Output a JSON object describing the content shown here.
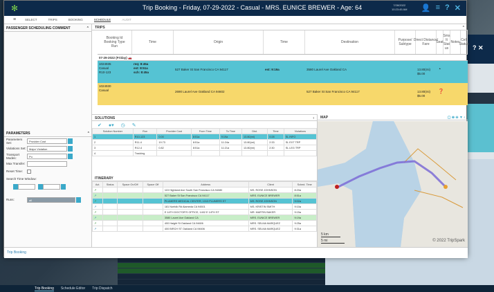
{
  "window": {
    "title": "Trip Booking - Friday, 07-29-2022 - Casual - MRS. EUNICE BREWER - Age: 64",
    "datetime": "7/28/2022\n10:23:45 AM"
  },
  "menu": {
    "items": [
      "SELECT",
      "TRIPS",
      "BOOKING",
      "SCHEDULE",
      "AUDIT"
    ],
    "selected": "SCHEDULE"
  },
  "left_panel": {
    "header": "PASSENGER SCHEDULING COMMENT",
    "params_header": "PARAMETERS",
    "params": [
      {
        "label": "Parameters Set:",
        "value": "Provider Cost"
      },
      {
        "label": "Violations Set:",
        "value": "Major Violation"
      },
      {
        "label": "Transport Modes:",
        "value": "Pu"
      },
      {
        "label": "Max Transfer:",
        "value": ""
      },
      {
        "label": "Reset Time:",
        "value": ""
      },
      {
        "label": "Search Time Window:",
        "value": ""
      },
      {
        "label": "Runs:",
        "value": "all"
      }
    ]
  },
  "trips": {
    "header": "TRIPS",
    "columns": [
      "Booking Id\nBooking Type\nRun",
      "Time",
      "Origin",
      "Time",
      "Destination",
      "Purpose/\nSubtype",
      "Direct Distance/\nFare",
      "Seat",
      "Sms\nIt\nStat\nus",
      "Notes",
      "Cell\nStatus"
    ],
    "date_label": "07-29-2022 (Friday)",
    "rows": [
      {
        "id": "1024935\nCasual\nR10-123",
        "time": "req: 8:45a\nest: 8:51a\nsch: 8:45a",
        "origin": "527 Baker St San Francisco CA 94117",
        "dtime": "est: 9:19a",
        "dest": "3580 Laurel Ave Oakland CA",
        "fare": "13.80(mi)\n$5.00",
        "style": "cyan"
      },
      {
        "id": "1024930\nCasual",
        "time": "",
        "origin": "2690 Laurel Ave Oakland CA 94602",
        "dtime": "",
        "dest": "527 Baker St San Francisco CA 94117",
        "fare": "13.80(mi)\n$5.00",
        "style": "yel"
      }
    ]
  },
  "solutions": {
    "header": "SOLUTIONS",
    "columns": [
      "Solution Number",
      "Run",
      "Provider Cost",
      "From Time",
      "To Time",
      "Dist.",
      "Time",
      "Violations"
    ],
    "rows": [
      [
        "1",
        "R10-123",
        "0.00",
        "8:51a",
        "9:19a",
        "13.80(mi)",
        "0:28",
        "SL INFO"
      ],
      [
        "2",
        "R11-4",
        "19.73",
        "8:51a",
        "11:24a",
        "13.80(mi)",
        "2:33",
        "SL EXT TRP"
      ],
      [
        "3",
        "R12-4",
        "0.82",
        "8:51a",
        "11:21a",
        "13.80(mi)",
        "2:30",
        "SL LEG TRP"
      ],
      [
        "4",
        "Tracking",
        "",
        "",
        "",
        "",
        "",
        ""
      ]
    ]
  },
  "itinerary": {
    "header": "ITINERARY",
    "columns": [
      "Act.",
      "Status",
      "Space On/Off",
      "Space Off",
      "Address",
      "Client",
      "Sched. Time"
    ],
    "rows": [
      {
        "s": "",
        "addr": "115 Highland Ave South San Francisco CA 94080",
        "client": "MS. ROSE JOHNSON",
        "t": "8:20a",
        "st": ""
      },
      {
        "s": "g",
        "addr": "527 Baker St San Francisco CA 94117",
        "client": "MRS. EUNICE BREWER",
        "t": "8:51a",
        "st": "g"
      },
      {
        "s": "c",
        "addr": "PLUMERS MEDICAL CENTER, 1313 PLUMERS ST",
        "client": "MS. ROSE JOHNSON",
        "t": "9:02a",
        "st": "c"
      },
      {
        "s": "",
        "addr": "181 Norfolk Rd Alameda CA 94501",
        "client": "MS. KRISTIN SMITH",
        "t": "9:10a",
        "st": ""
      },
      {
        "s": "",
        "addr": "E 14TH DOCTOR'S OFFICE, 1402 E 14TH ST",
        "client": "MR. MARTIN BAKER",
        "t": "9:15a",
        "st": ""
      },
      {
        "s": "g",
        "addr": "3580 Laurel Ave Oakland CA",
        "client": "MRS. EUNICE BREWER",
        "t": "9:19a",
        "st": "g"
      },
      {
        "s": "",
        "addr": "400 Haight St Oakland CA 94606",
        "client": "MRS. SELMA MARQUEZ",
        "t": "9:25a",
        "st": ""
      },
      {
        "s": "",
        "addr": "400 BIRCH ST Oakland CA 94606",
        "client": "MRS. SELMA MARQUEZ",
        "t": "9:31a",
        "st": ""
      }
    ]
  },
  "map": {
    "header": "MAP",
    "scale_km": "5 km",
    "scale_mi": "5 mi",
    "copyright": "© 2022 TripSpark"
  },
  "status": {
    "tab": "Trip Booking"
  },
  "taskbar": {
    "tabs": [
      "Trip Booking",
      "Schedule Editor",
      "Trip Dispatch"
    ]
  },
  "colors": {
    "titlebar": "#0d2a4a",
    "cyan": "#55c3d3",
    "yellow": "#f7d86b",
    "accent": "#3aa9c9"
  }
}
